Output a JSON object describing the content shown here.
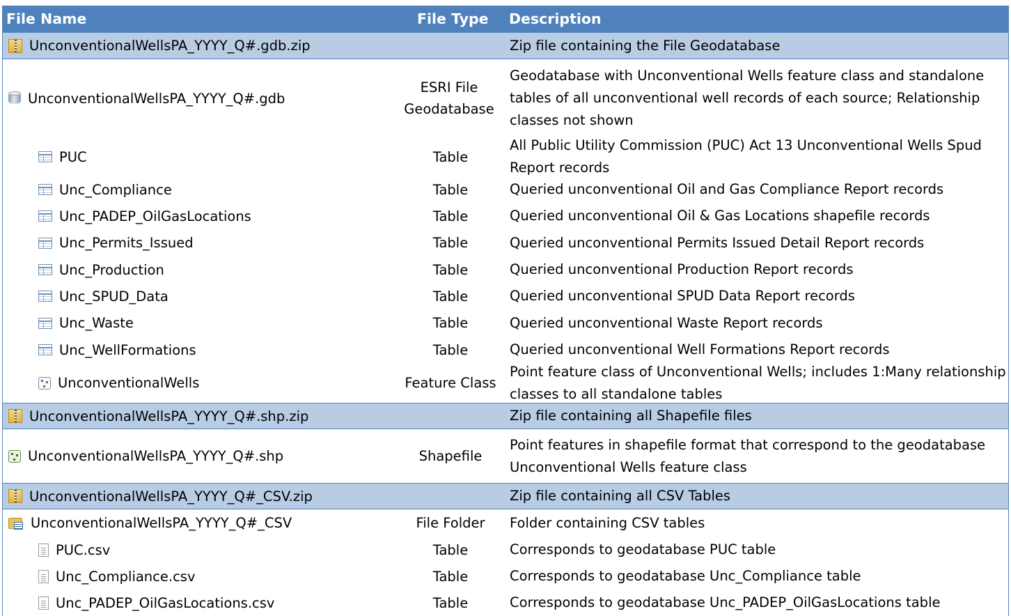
{
  "header": {
    "file_name": "File Name",
    "file_type": "File Type",
    "description": "Description"
  },
  "rows": [
    {
      "icon": "zip-icon",
      "name": "UnconventionalWellsPA_YYYY_Q#.gdb.zip",
      "type": "",
      "description": "Zip file containing the File Geodatabase"
    },
    {
      "icon": "geodatabase-icon",
      "name": "UnconventionalWellsPA_YYYY_Q#.gdb",
      "type": "ESRI File Geodatabase",
      "description": "Geodatabase with Unconventional Wells feature class and standalone tables of all unconventional well records of each source; Relationship classes not shown"
    },
    {
      "icon": "table-icon",
      "name": "PUC",
      "type": "Table",
      "description": "All Public Utility Commission (PUC) Act 13 Unconventional Wells Spud Report records"
    },
    {
      "icon": "table-icon",
      "name": "Unc_Compliance",
      "type": "Table",
      "description": "Queried unconventional Oil and Gas Compliance Report records"
    },
    {
      "icon": "table-icon",
      "name": "Unc_PADEP_OilGasLocations",
      "type": "Table",
      "description": "Queried unconventional Oil & Gas Locations shapefile records"
    },
    {
      "icon": "table-icon",
      "name": "Unc_Permits_Issued",
      "type": "Table",
      "description": "Queried unconventional Permits Issued Detail Report records"
    },
    {
      "icon": "table-icon",
      "name": "Unc_Production",
      "type": "Table",
      "description": "Queried unconventional Production Report records"
    },
    {
      "icon": "table-icon",
      "name": "Unc_SPUD_Data",
      "type": "Table",
      "description": "Queried unconventional SPUD Data Report records"
    },
    {
      "icon": "table-icon",
      "name": "Unc_Waste",
      "type": "Table",
      "description": "Queried unconventional Waste Report records"
    },
    {
      "icon": "table-icon",
      "name": "Unc_WellFormations",
      "type": "Table",
      "description": "Queried unconventional Well Formations Report records"
    },
    {
      "icon": "point-feature-class-icon",
      "name": "UnconventionalWells",
      "type": "Feature Class",
      "description": "Point feature class of Unconventional Wells; includes 1:Many relationship classes to all standalone tables"
    },
    {
      "icon": "zip-icon",
      "name": "UnconventionalWellsPA_YYYY_Q#.shp.zip",
      "type": "",
      "description": "Zip file containing all Shapefile files"
    },
    {
      "icon": "shapefile-icon",
      "name": "UnconventionalWellsPA_YYYY_Q#.shp",
      "type": "Shapefile",
      "description": "Point features in shapefile format that correspond to the geodatabase Unconventional Wells feature class"
    },
    {
      "icon": "zip-icon",
      "name": "UnconventionalWellsPA_YYYY_Q#_CSV.zip",
      "type": "",
      "description": "Zip file containing all CSV Tables"
    },
    {
      "icon": "folder-table-icon",
      "name": "UnconventionalWellsPA_YYYY_Q#_CSV",
      "type": "File Folder",
      "description": "Folder containing CSV tables"
    },
    {
      "icon": "csv-file-icon",
      "name": "PUC.csv",
      "type": "Table",
      "description": "Corresponds to geodatabase PUC table"
    },
    {
      "icon": "csv-file-icon",
      "name": "Unc_Compliance.csv",
      "type": "Table",
      "description": "Corresponds to geodatabase Unc_Compliance table"
    },
    {
      "icon": "csv-file-icon",
      "name": "Unc_PADEP_OilGasLocations.csv",
      "type": "Table",
      "description": "Corresponds to geodatabase Unc_PADEP_OilGasLocations table"
    }
  ],
  "colors": {
    "header_bg": "#4f81bd",
    "zip_row_bg": "#b8cce4"
  }
}
